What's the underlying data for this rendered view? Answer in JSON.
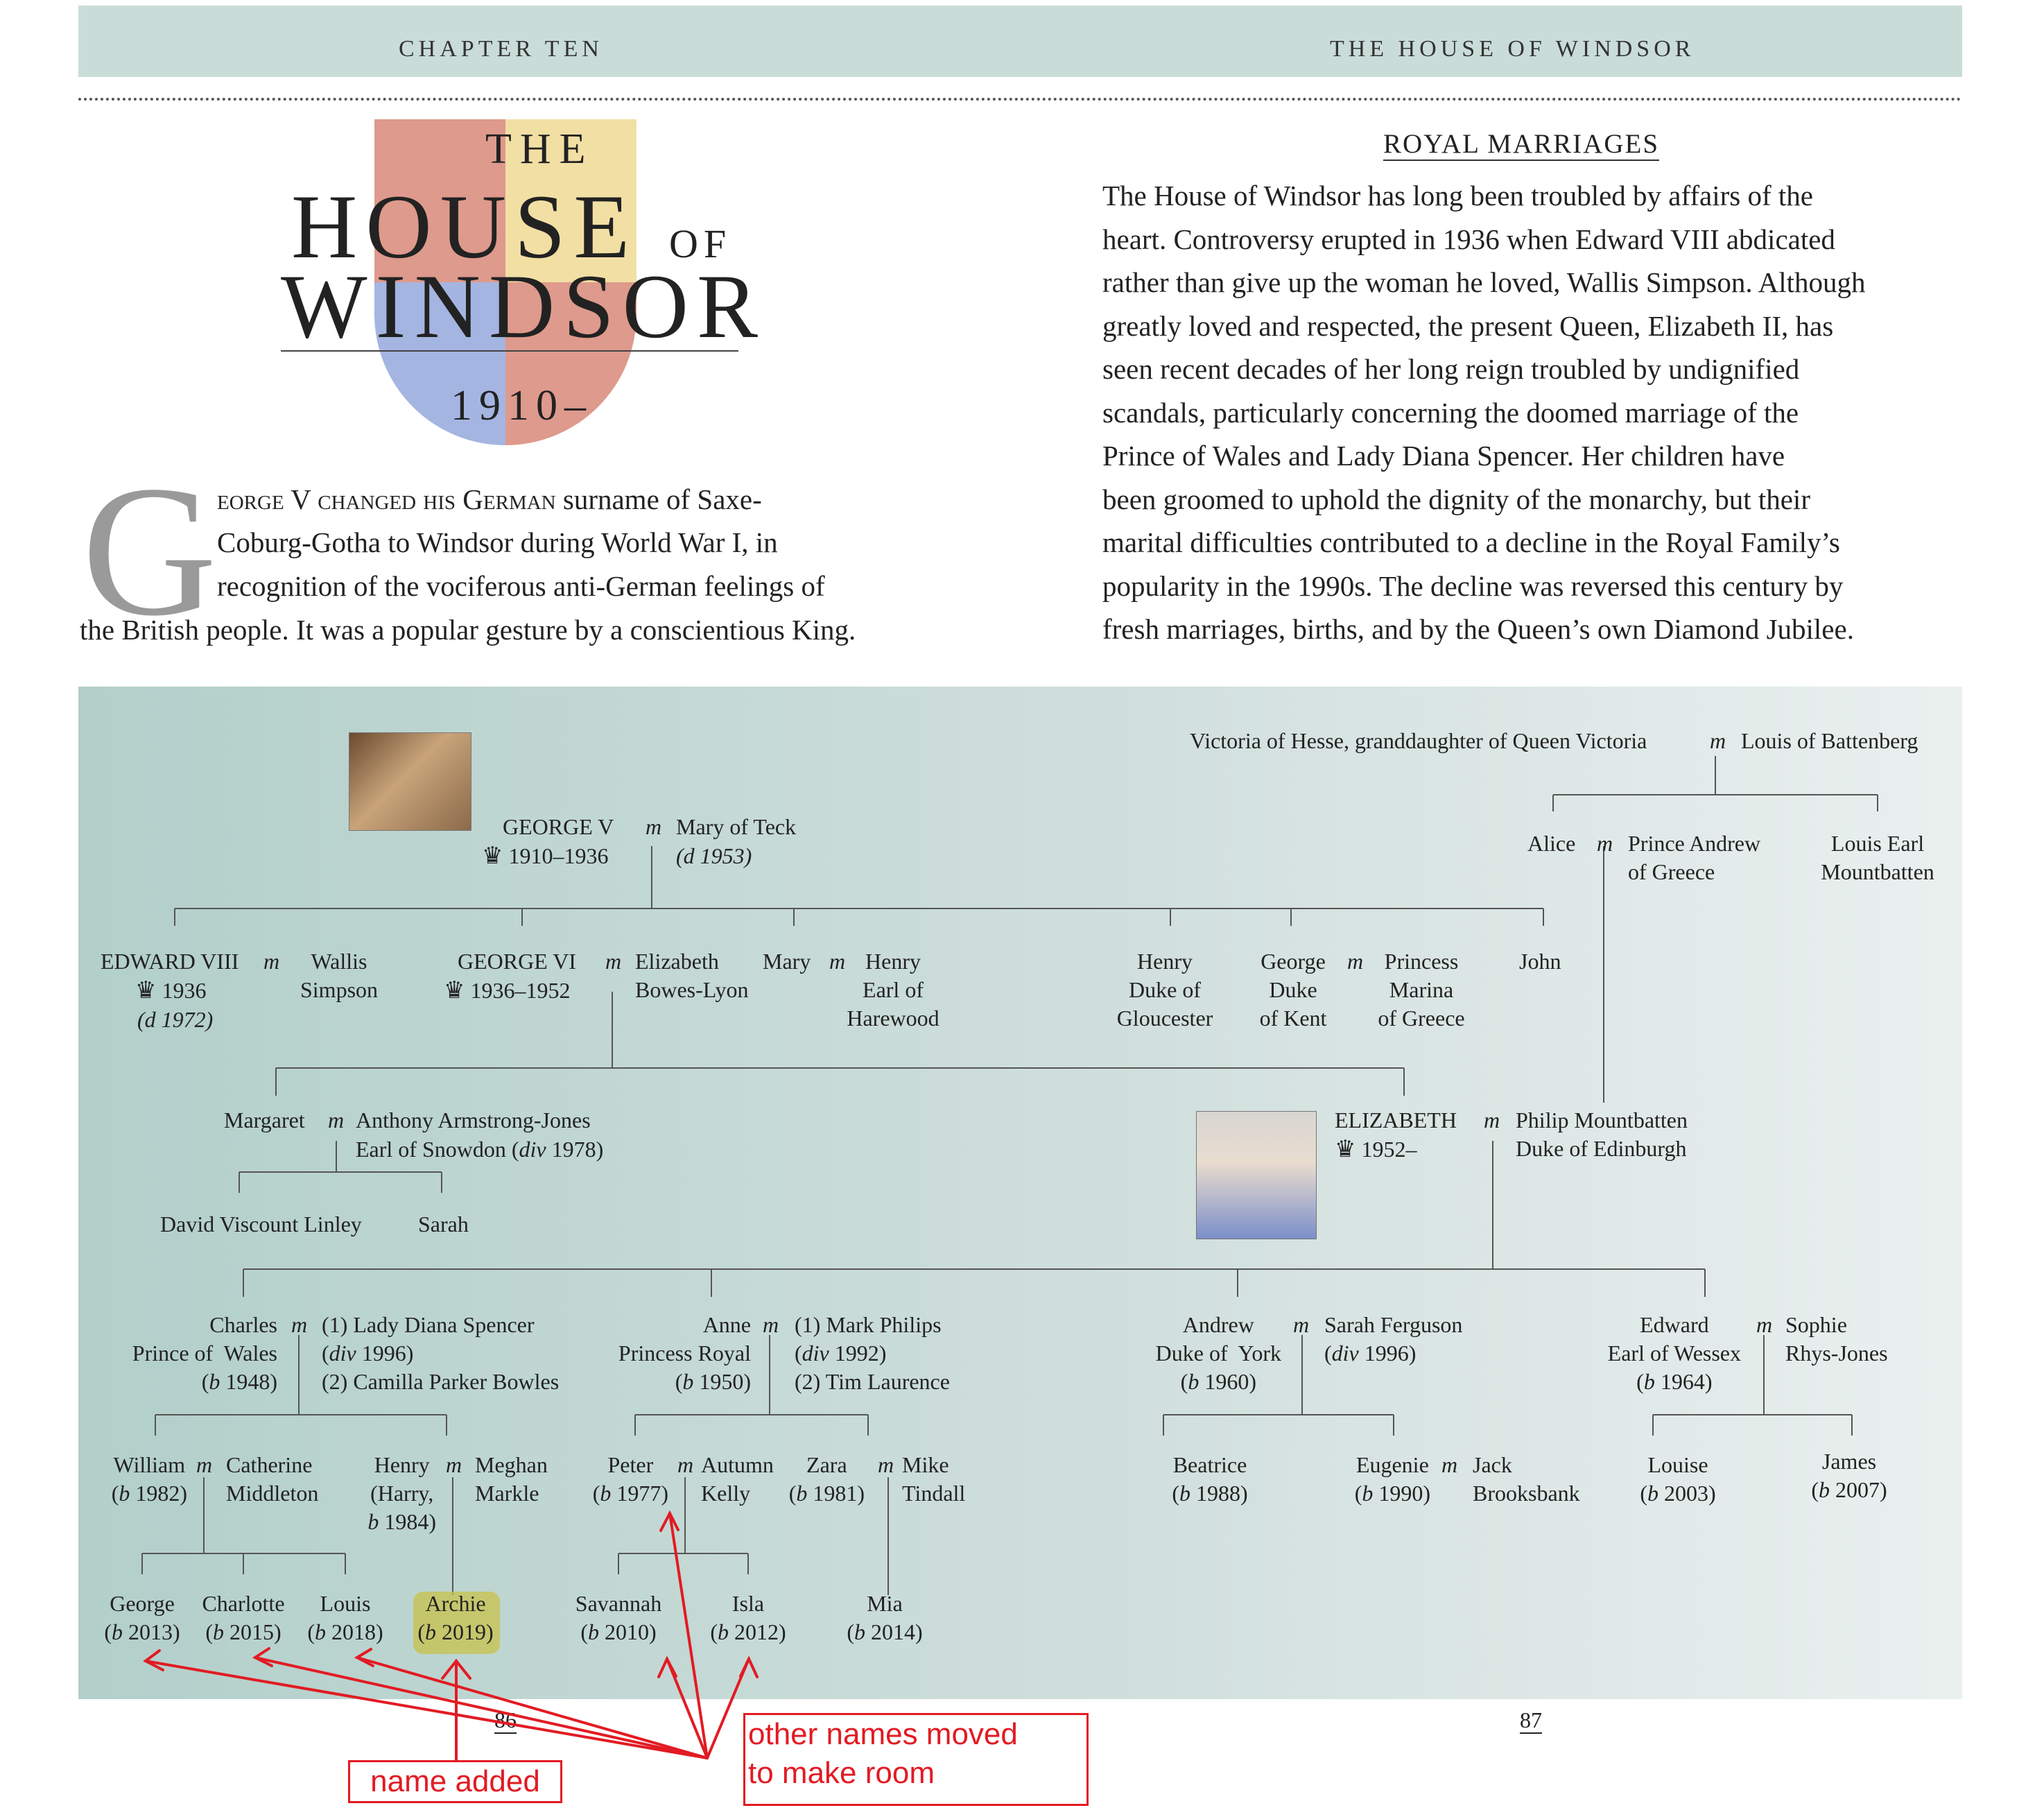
{
  "header": {
    "left": "CHAPTER TEN",
    "right": "THE HOUSE OF WINDSOR"
  },
  "title": {
    "the": "THE",
    "house": "HOUSE",
    "of": "OF",
    "windsor": "WINDSOR",
    "year": "1910–"
  },
  "intro": {
    "dropcap": "G",
    "line1_sc": "eorge V changed his German",
    "line1_rest": " surname of Saxe-",
    "line2": "Coburg-Gotha to Windsor during World War I, in",
    "line3": "recognition of the vociferous anti-German feelings of",
    "line4": "the British people. It was a popular gesture by a conscientious King."
  },
  "royal_marriages": {
    "heading": "ROYAL MARRIAGES",
    "lines": [
      "The House of Windsor has long been troubled by affairs of the",
      "heart. Controversy erupted in 1936 when Edward VIII abdicated",
      "rather than give up the woman he loved, Wallis Simpson. Although",
      "greatly loved and respected, the present Queen, Elizabeth II, has",
      "seen recent decades of her long reign troubled by undignified",
      "scandals, particularly concerning the doomed marriage of the",
      "Prince of  Wales and Lady Diana Spencer. Her children have",
      "been groomed to uphold the dignity of the monarchy, but their",
      "marital difficulties contributed to a decline in the Royal Family’s",
      "popularity in the 1990s. The decline was reversed this century by",
      "fresh marriages, births, and by the Queen’s own Diamond Jubilee."
    ]
  },
  "tree": {
    "m": "m",
    "crown": "♛",
    "victoria": "Victoria of Hesse, granddaughter of Queen Victoria",
    "louis_b": "Louis of Battenberg",
    "alice": "Alice",
    "andrew_greece": "Prince Andrew\nof Greece",
    "louis_mount": "Louis Earl\nMountbatten",
    "george5": "GEORGE V",
    "george5_reign": "1910–1936",
    "mary_teck": "Mary of  Teck",
    "mary_teck_d": "(d 1953)",
    "edward8": "EDWARD VIII",
    "edward8_reign": "1936",
    "edward8_d": "(d 1972)",
    "wallis": "Wallis\nSimpson",
    "george6": "GEORGE VI",
    "george6_reign": "1936–1952",
    "elizabeth_bl": "Elizabeth\nBowes-Lyon",
    "mary": "Mary",
    "henry_harewood": "Henry\nEarl of\nHarewood",
    "henry_glou": "Henry\nDuke of\nGloucester",
    "george_kent": "George\nDuke\nof Kent",
    "marina": "Princess\nMarina\nof Greece",
    "john": "John",
    "margaret": "Margaret",
    "armstrong": "Anthony Armstrong-Jones",
    "snowdon": "Earl of Snowdon (div 1978)",
    "linley": "David  Viscount  Linley",
    "sarah": "Sarah",
    "elizabeth2": "ELIZABETH",
    "elizabeth2_reign": "1952–",
    "philip": "Philip Mountbatten\nDuke of Edinburgh",
    "charles": "Charles\nPrince of  Wales\n(b 1948)",
    "charles_spouses": "(1) Lady Diana Spencer\n(div 1996)\n(2) Camilla Parker Bowles",
    "anne": "Anne\nPrincess Royal\n(b 1950)",
    "anne_spouses": "(1) Mark Philips\n(div 1992)\n(2) Tim Laurence",
    "andrew": "Andrew\nDuke of  York\n(b 1960)",
    "sarah_f": "Sarah Ferguson\n(div 1996)",
    "edward": "Edward\nEarl of Wessex\n(b 1964)",
    "sophie": "Sophie\nRhys-Jones",
    "william": "William\n(b 1982)",
    "catherine": "Catherine\nMiddleton",
    "henry": "Henry\n(Harry,\nb 1984)",
    "meghan": "Meghan\nMarkle",
    "peter": "Peter\n(b 1977)",
    "autumn": "Autumn\nKelly",
    "zara": "Zara\n(b 1981)",
    "mike": "Mike\nTindall",
    "beatrice": "Beatrice\n(b 1988)",
    "eugenie": "Eugenie\n(b 1990)",
    "jack": "Jack\nBrooksbank",
    "louise": "Louise\n(b 2003)",
    "james": "James\n(b 2007)",
    "george": "George\n(b 2013)",
    "charlotte": "Charlotte\n(b 2015)",
    "louis": "Louis\n(b 2018)",
    "archie": "Archie\n(b 2019)",
    "savannah": "Savannah\n(b 2010)",
    "isla": "Isla\n(b 2012)",
    "mia": "Mia\n(b 2014)"
  },
  "page_numbers": {
    "left": "86",
    "right": "87"
  },
  "annotations": {
    "added": "name added",
    "moved": "other names moved\nto make room",
    "color": "#e21b23"
  },
  "colors": {
    "header_band": "#c9dcd8",
    "highlight": "#c8c24a"
  }
}
